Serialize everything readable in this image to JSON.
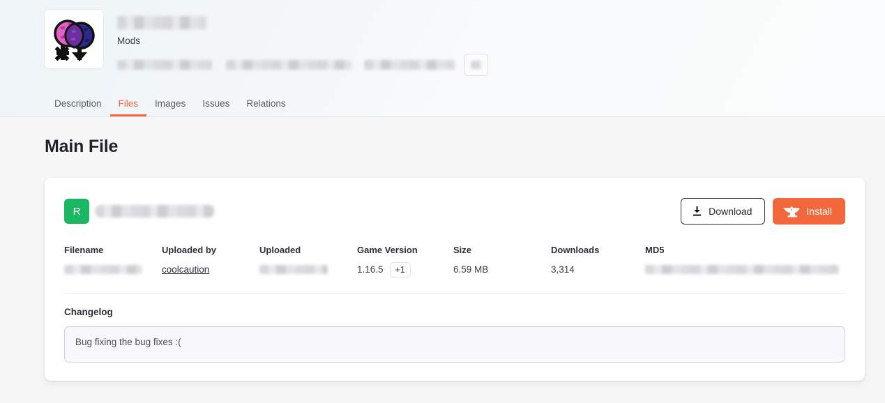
{
  "header": {
    "avatar_icon": "two-planets-gender-symbol-logo",
    "title_redacted": true,
    "category_label": "Mods",
    "stats_redacted": true
  },
  "tabs": [
    {
      "label": "Description",
      "active": false
    },
    {
      "label": "Files",
      "active": true
    },
    {
      "label": "Images",
      "active": false
    },
    {
      "label": "Issues",
      "active": false
    },
    {
      "label": "Relations",
      "active": false
    }
  ],
  "main": {
    "section_title": "Main File"
  },
  "file": {
    "release_badge": "R",
    "filename_redacted": true,
    "download_label": "Download",
    "install_label": "Install",
    "download_icon": "download-arrow-icon",
    "install_icon": "curseforge-anvil-icon"
  },
  "details": {
    "headers": [
      "Filename",
      "Uploaded by",
      "Uploaded",
      "Game Version",
      "Size",
      "Downloads",
      "MD5"
    ],
    "values": {
      "filename": "",
      "uploaded_by": "coolcaution",
      "uploaded": "",
      "game_version": "1.16.5",
      "game_version_more": "+1",
      "size": "6.59 MB",
      "downloads": "3,314",
      "md5": ""
    }
  },
  "changelog": {
    "title": "Changelog",
    "text": "Bug fixing the bug fixes :("
  },
  "colors": {
    "accent_orange": "#f2683c",
    "release_green": "#1bb763",
    "page_background": "#f7f7f8",
    "card_background": "#ffffff",
    "changelog_border": "#d5c9e8"
  }
}
